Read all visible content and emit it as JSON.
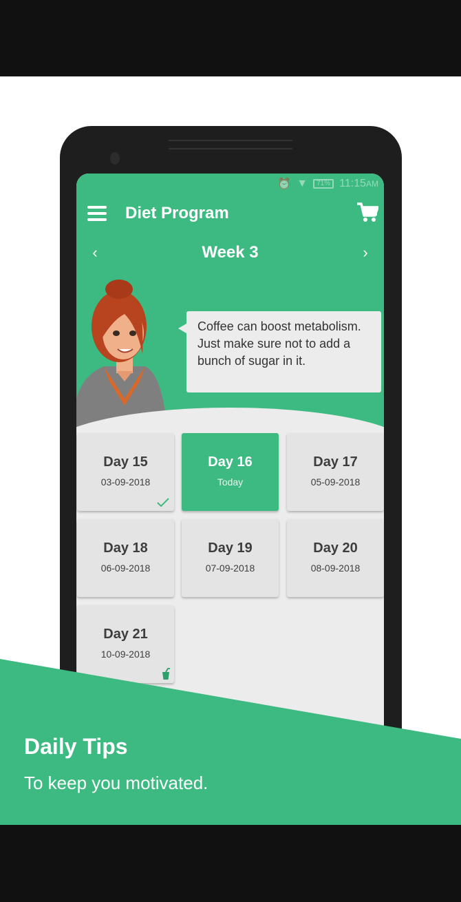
{
  "status_bar": {
    "time": "11:15",
    "ampm": "AM",
    "battery": "71%"
  },
  "toolbar": {
    "title": "Diet Program"
  },
  "week_nav": {
    "title": "Week 3"
  },
  "tip": {
    "text": "Coffee can boost metabolism. Just make sure not to add a bunch of sugar in it."
  },
  "days": [
    {
      "label": "Day 15",
      "date": "03-09-2018",
      "status": "completed"
    },
    {
      "label": "Day 16",
      "date": "Today",
      "status": "today"
    },
    {
      "label": "Day 17",
      "date": "05-09-2018",
      "status": "upcoming"
    },
    {
      "label": "Day 18",
      "date": "06-09-2018",
      "status": "upcoming"
    },
    {
      "label": "Day 19",
      "date": "07-09-2018",
      "status": "upcoming"
    },
    {
      "label": "Day 20",
      "date": "08-09-2018",
      "status": "upcoming"
    },
    {
      "label": "Day 21",
      "date": "10-09-2018",
      "status": "cheat-day"
    }
  ],
  "banner": {
    "title": "Daily Tips",
    "subtitle": "To keep you motivated."
  },
  "colors": {
    "accent": "#3dba81",
    "card": "#e4e4e4",
    "background": "#ececec",
    "text": "#3d3d3d"
  }
}
